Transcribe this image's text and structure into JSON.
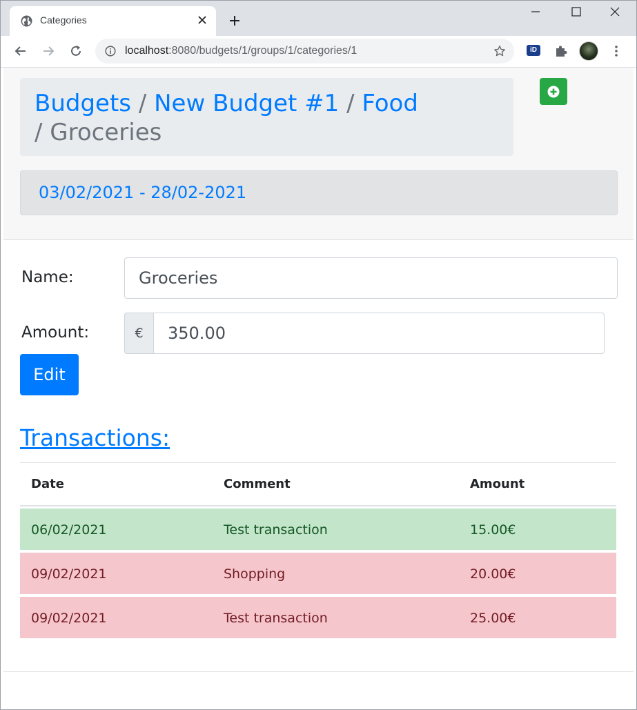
{
  "browser": {
    "tab_title": "Categories",
    "url_host": "localhost",
    "url_path": ":8080/budgets/1/groups/1/categories/1",
    "extension_label": "iD"
  },
  "breadcrumb": {
    "items": [
      "Budgets",
      "New Budget #1",
      "Food"
    ],
    "separator": "/",
    "active": "Groceries"
  },
  "date_range": "03/02/2021 - 28/02-2021",
  "form": {
    "name_label": "Name:",
    "name_value": "Groceries",
    "amount_label": "Amount:",
    "currency_symbol": "€",
    "amount_value": "350.00",
    "edit_label": "Edit"
  },
  "transactions": {
    "heading": "Transactions:",
    "columns": [
      "Date",
      "Comment",
      "Amount"
    ],
    "rows": [
      {
        "date": "06/02/2021",
        "comment": "Test transaction",
        "amount": "15.00€",
        "status": "income"
      },
      {
        "date": "09/02/2021",
        "comment": "Shopping",
        "amount": "20.00€",
        "status": "expense"
      },
      {
        "date": "09/02/2021",
        "comment": "Test transaction",
        "amount": "25.00€",
        "status": "expense"
      }
    ]
  },
  "colors": {
    "link": "#007bff",
    "success": "#28a745",
    "row_income": "#c3e6cb",
    "row_expense": "#f5c6cb"
  },
  "icons": {
    "tab": "globe-icon",
    "add": "plus-circle-icon"
  }
}
